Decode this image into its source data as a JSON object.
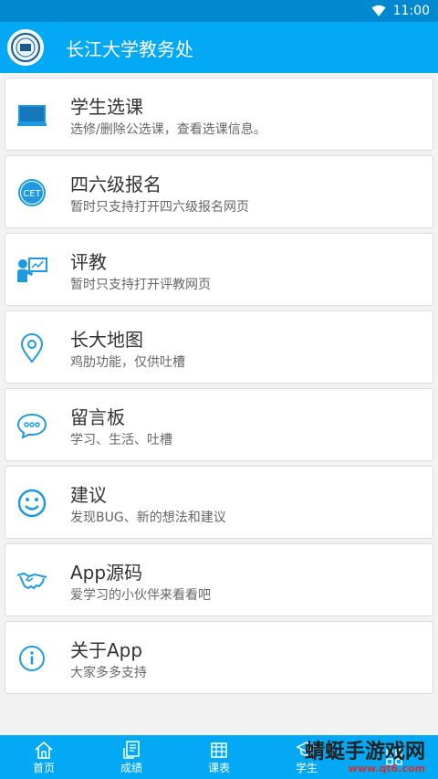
{
  "status": {
    "time": "11:00"
  },
  "app": {
    "title": "长江大学教务处"
  },
  "colors": {
    "primary": "#03a9f4",
    "dark": "#0288d1",
    "icon": "#1e9be0"
  },
  "items": [
    {
      "title": "学生选课",
      "subtitle": "选修/删除公选课，查看选课信息。",
      "icon": "board-icon"
    },
    {
      "title": "四六级报名",
      "subtitle": "暂时只支持打开四六级报名网页",
      "icon": "cet-icon"
    },
    {
      "title": "评教",
      "subtitle": "暂时只支持打开评教网页",
      "icon": "teacher-icon"
    },
    {
      "title": "长大地图",
      "subtitle": "鸡肋功能，仅供吐槽",
      "icon": "location-pin-icon"
    },
    {
      "title": "留言板",
      "subtitle": "学习、生活、吐槽",
      "icon": "chat-bubble-icon"
    },
    {
      "title": "建议",
      "subtitle": "发现BUG、新的想法和建议",
      "icon": "smiley-icon"
    },
    {
      "title": "App源码",
      "subtitle": "爱学习的小伙伴来看看吧",
      "icon": "handshake-icon"
    },
    {
      "title": "关于App",
      "subtitle": "大家多多支持",
      "icon": "info-icon"
    }
  ],
  "nav": [
    {
      "label": "首页",
      "icon": "home-icon"
    },
    {
      "label": "成绩",
      "icon": "grades-icon"
    },
    {
      "label": "课表",
      "icon": "calendar-icon"
    },
    {
      "label": "学生",
      "icon": "cap-icon"
    },
    {
      "label": "",
      "icon": "grid-icon"
    }
  ],
  "cet_label": "CET",
  "watermark": {
    "title": "蜻蜓手游戏网",
    "url": "www.qt6.com"
  }
}
